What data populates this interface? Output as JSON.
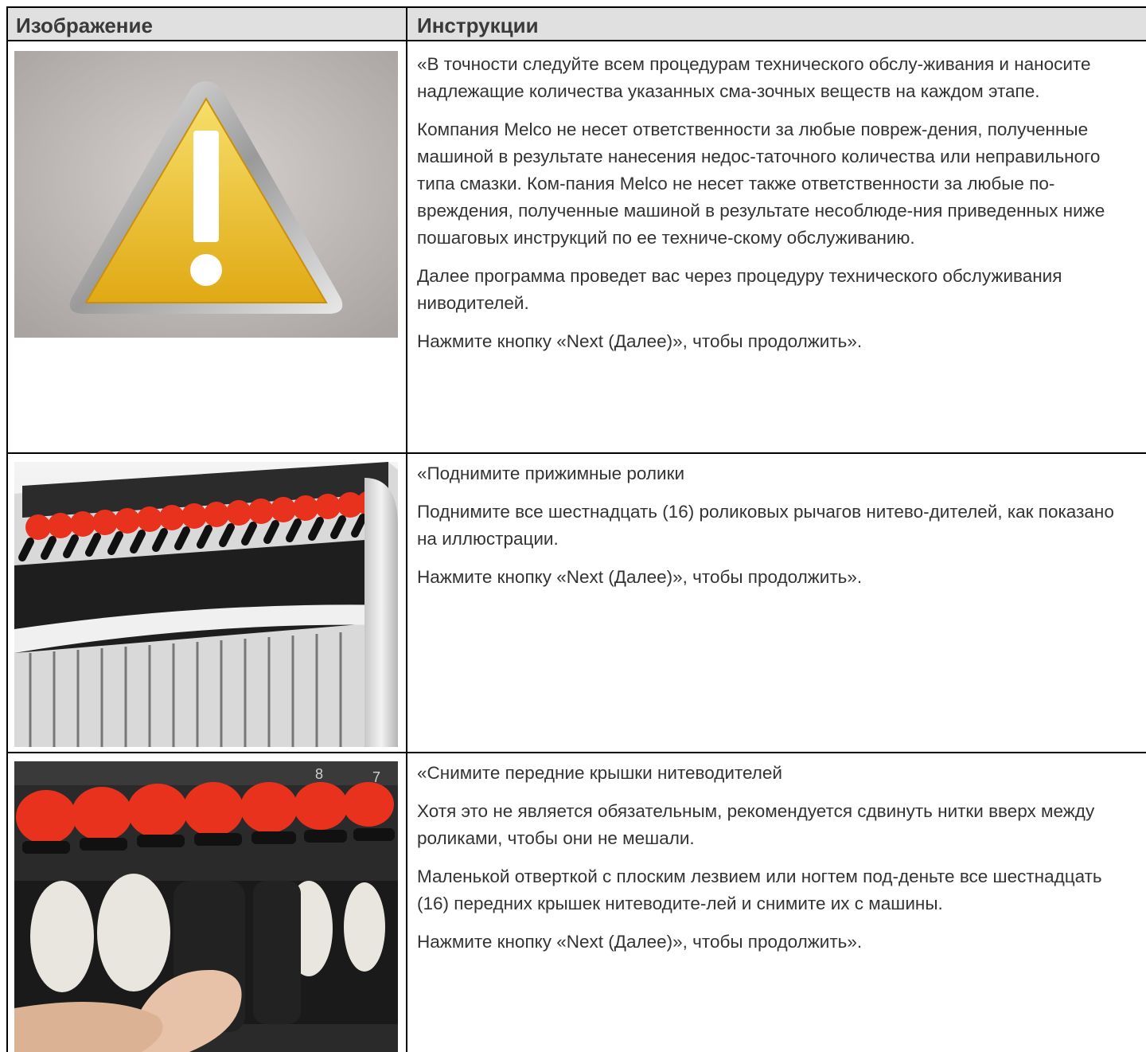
{
  "table": {
    "headers": {
      "image": "Изображение",
      "instructions": "Инструкции"
    },
    "rows": [
      {
        "image_icon": "warning-triangle-icon",
        "paragraphs": [
          "«В точности следуйте всем процедурам технического обслу-живания и наносите надлежащие количества указанных сма-зочных веществ на каждом этапе.",
          "Компания Melco не несет ответственности за любые повреж-дения, полученные машиной в результате нанесения недос-таточного количества или неправильного типа смазки. Ком-пания Melco не несет также ответственности за любые по-вреждения, полученные машиной в результате несоблюде-ния приведенных ниже пошаговых инструкций по ее техниче-скому обслуживанию.",
          "Далее программа проведет вас через процедуру технического обслуживания ниводителей.",
          "Нажмите кнопку «Next (Далее)», чтобы продолжить»."
        ]
      },
      {
        "image_icon": "thread-take-up-rollers-photo",
        "paragraphs": [
          "«Поднимите прижимные ролики",
          "Поднимите все шестнадцать (16) роликовых рычагов нитево-дителей, как показано на иллюстрации.",
          "Нажмите кнопку «Next (Далее)», чтобы продолжить»."
        ]
      },
      {
        "image_icon": "thread-guide-cover-removal-photo",
        "paragraphs": [
          "«Снимите передние крышки нитеводителей",
          "Хотя это не является обязательным, рекомендуется сдвинуть нитки вверх между роликами, чтобы они не мешали.",
          "Маленькой отверткой с плоским лезвием или ногтем под-деньте все шестнадцать (16) передних крышек нитеводите-лей и снимите их с машины.",
          "Нажмите кнопку «Next (Далее)», чтобы продолжить»."
        ]
      }
    ]
  },
  "colors": {
    "header_bg": "#e0e0e0",
    "text": "#333333",
    "roller_red": "#e8321e",
    "warning_yellow": "#f1c232"
  },
  "machine_labels": [
    "8",
    "7"
  ]
}
